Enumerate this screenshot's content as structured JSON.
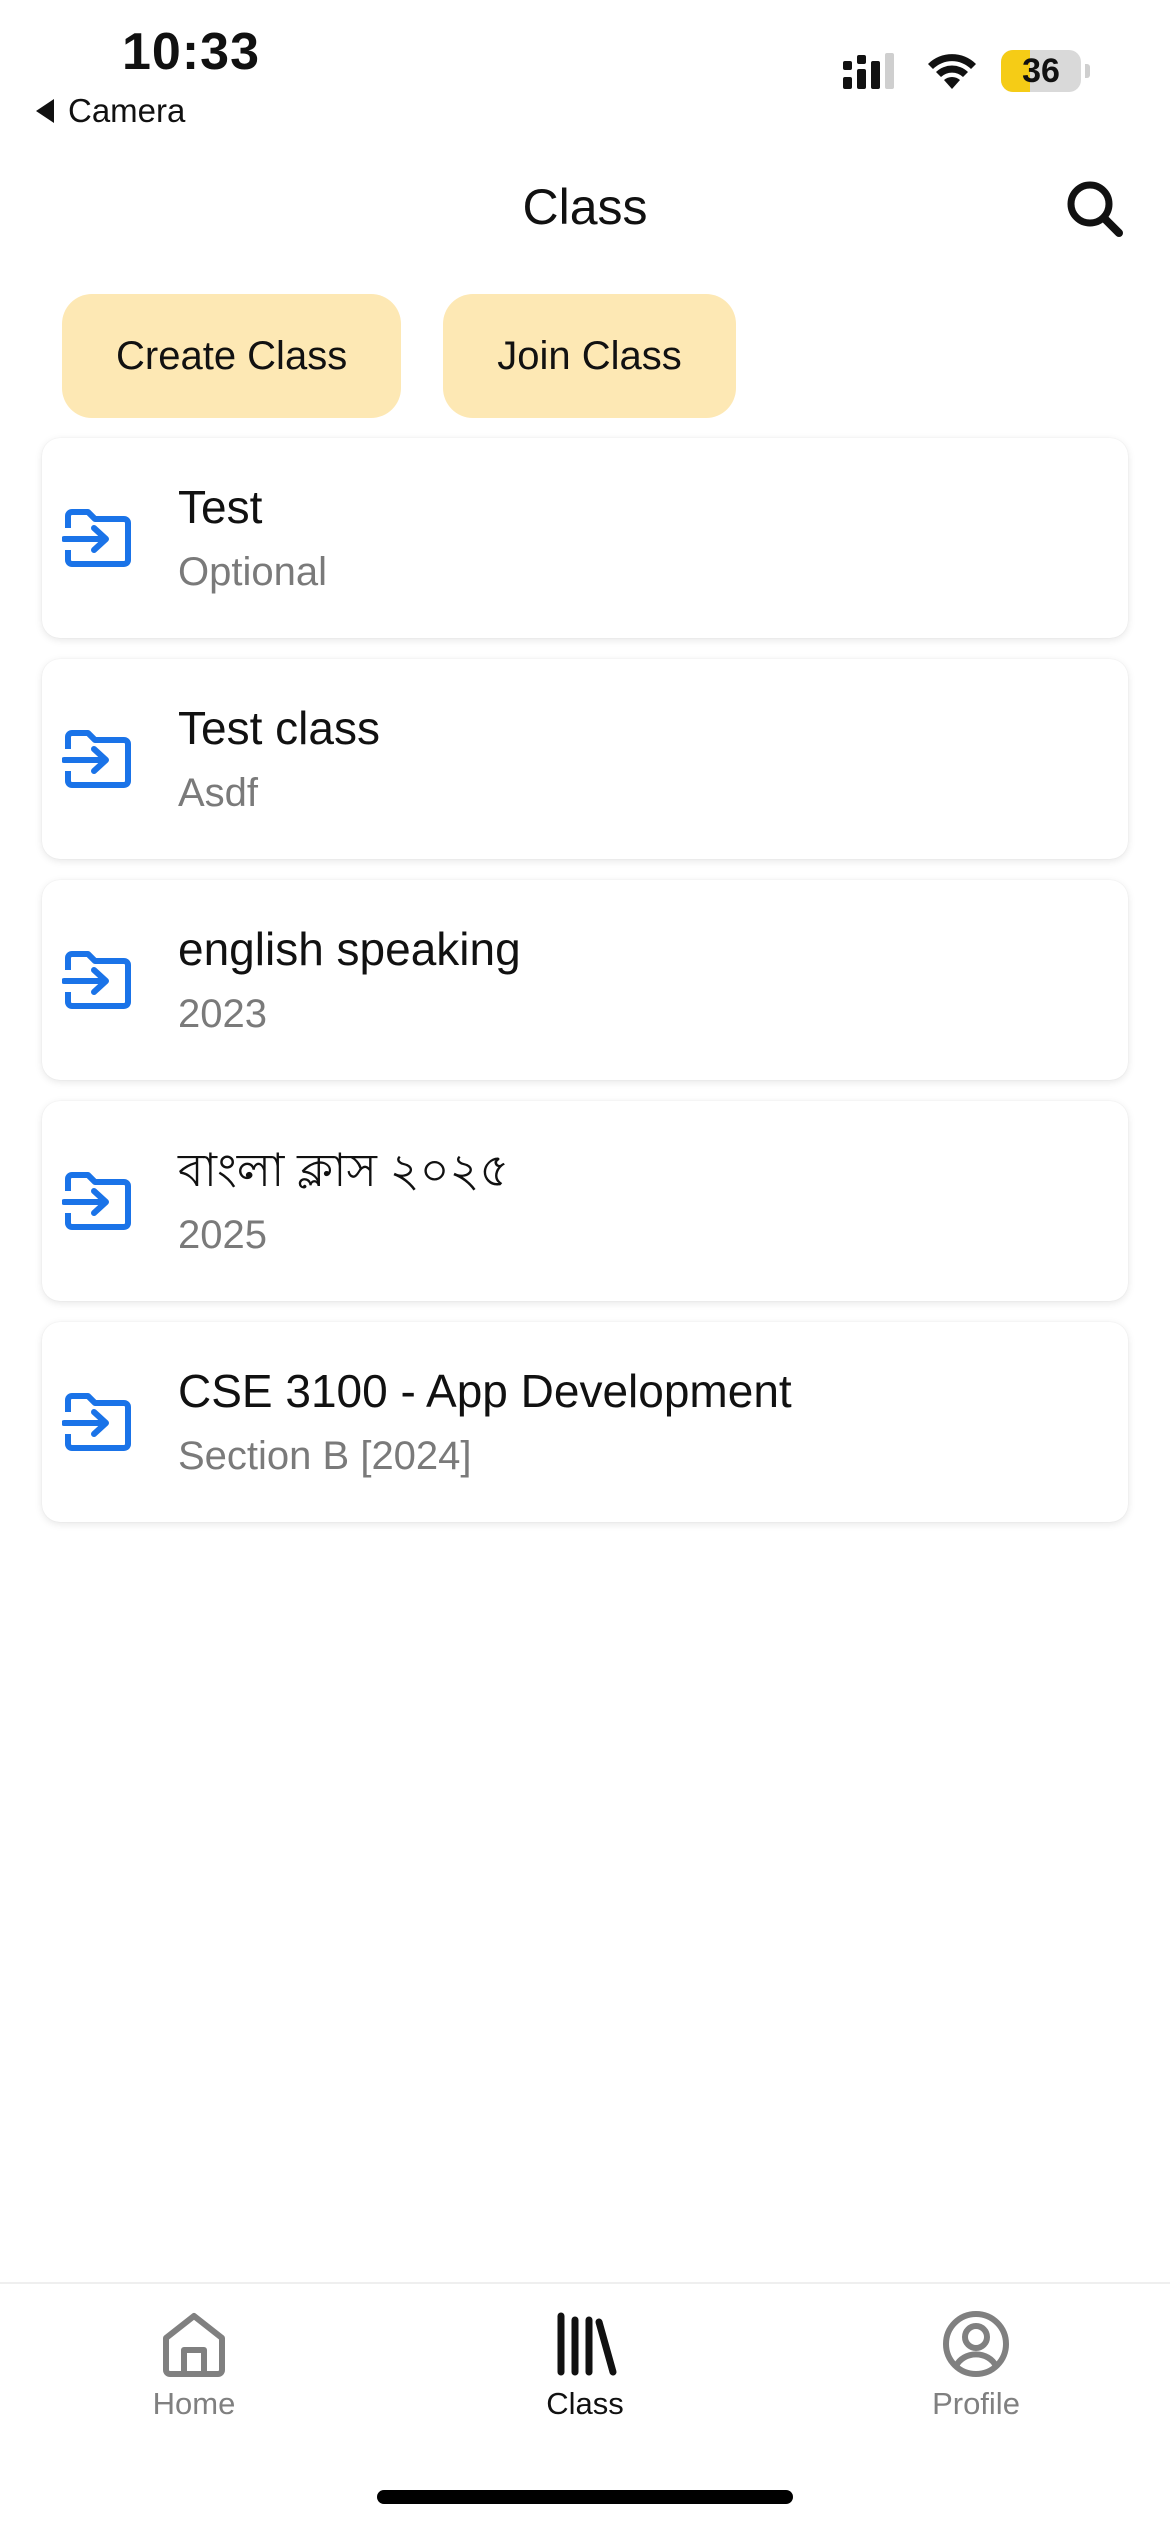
{
  "status_bar": {
    "time": "10:33",
    "back_label": "Camera",
    "battery_level": "36",
    "battery_fraction": 0.36
  },
  "header": {
    "title": "Class"
  },
  "actions": {
    "create_label": "Create Class",
    "join_label": "Join Class"
  },
  "classes": [
    {
      "title": "Test",
      "subtitle": "Optional"
    },
    {
      "title": "Test class",
      "subtitle": "Asdf"
    },
    {
      "title": "english speaking",
      "subtitle": "2023"
    },
    {
      "title": "বাংলা ক্লাস ২০২৫",
      "subtitle": "2025"
    },
    {
      "title": "CSE 3100 - App Development",
      "subtitle": "Section B [2024]"
    }
  ],
  "tabs": [
    {
      "label": "Home",
      "icon": "home-icon",
      "active": false
    },
    {
      "label": "Class",
      "icon": "library-icon",
      "active": true
    },
    {
      "label": "Profile",
      "icon": "profile-icon",
      "active": false
    }
  ],
  "colors": {
    "accent_button": "#fde8b4",
    "class_icon": "#1a73e8",
    "battery": "#f5cc16"
  }
}
